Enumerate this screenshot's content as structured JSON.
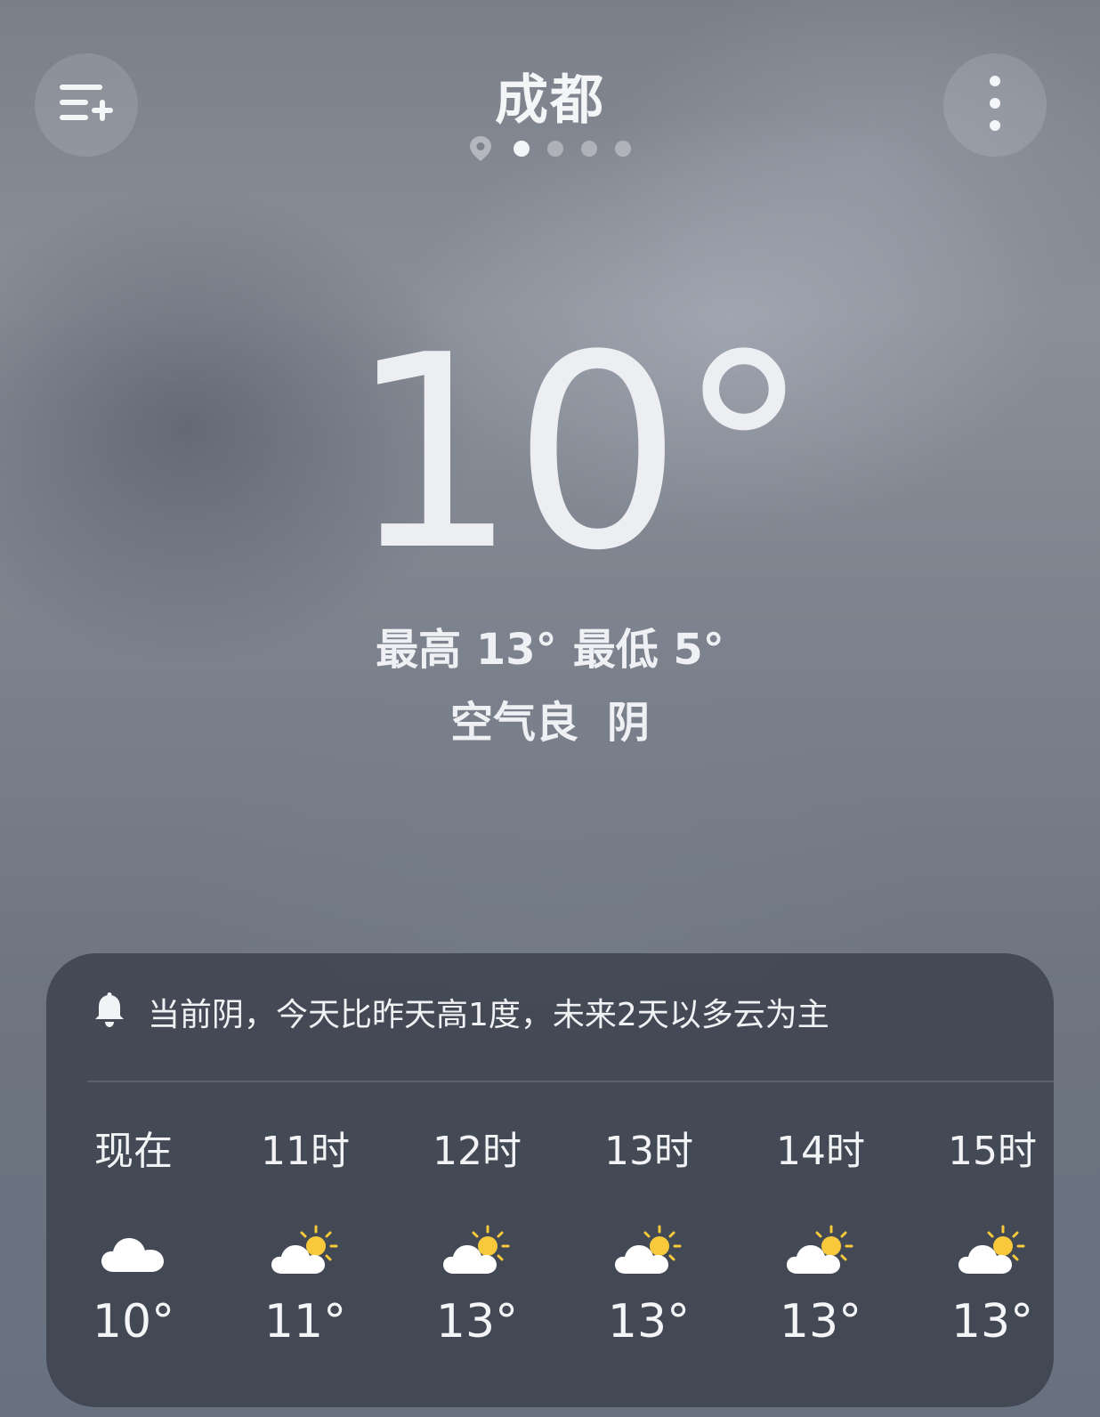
{
  "header": {
    "city": "成都",
    "left_button_icon": "add-city-list-icon",
    "right_button_icon": "more-vertical-icon",
    "pages": {
      "count": 4,
      "active_index": 0,
      "has_location_page": true
    }
  },
  "current": {
    "temperature": "10°",
    "high_label": "最高 13°",
    "low_label": "最低 5°",
    "air_quality": "空气良",
    "condition": "阴"
  },
  "forecast": {
    "alert_icon": "bell-icon",
    "alert_text": "当前阴，今天比昨天高1度，未来2天以多云为主",
    "hours": [
      {
        "label": "现在",
        "icon": "cloudy-icon",
        "temp": "10°"
      },
      {
        "label": "11时",
        "icon": "partly-cloudy-icon",
        "temp": "11°"
      },
      {
        "label": "12时",
        "icon": "partly-cloudy-icon",
        "temp": "13°"
      },
      {
        "label": "13时",
        "icon": "partly-cloudy-icon",
        "temp": "13°"
      },
      {
        "label": "14时",
        "icon": "partly-cloudy-icon",
        "temp": "13°"
      },
      {
        "label": "15时",
        "icon": "partly-cloudy-icon",
        "temp": "13°"
      }
    ]
  },
  "colors": {
    "sun": "#f7c93b",
    "text": "#f2f3f5",
    "card": "#3a404c"
  }
}
